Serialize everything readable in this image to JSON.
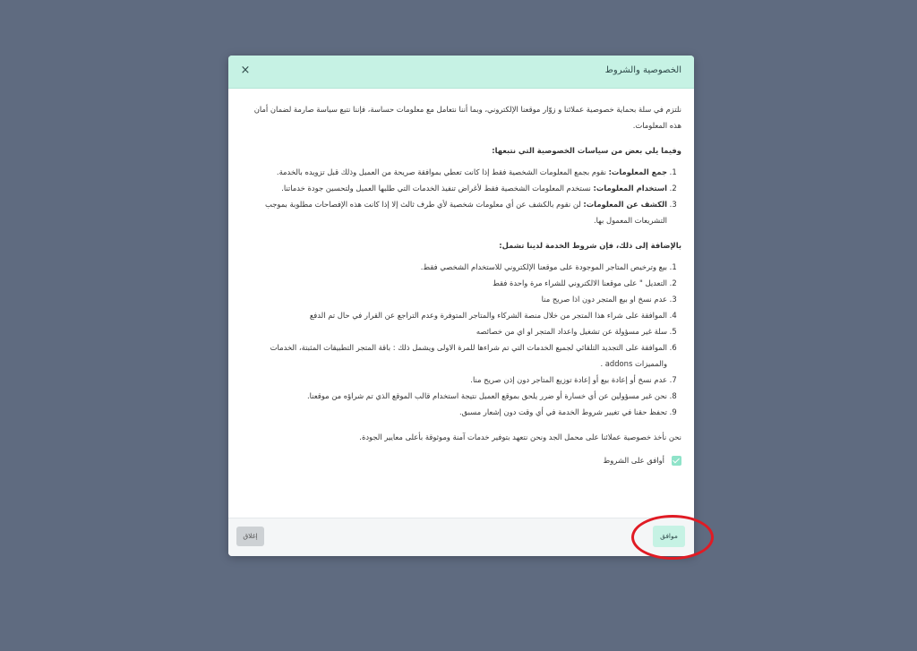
{
  "modal": {
    "title": "الخصوصية والشروط",
    "close_icon": "×",
    "intro": "نلتزم في سلة بحماية خصوصية عملائنا و زوّار موقعنا الإلكتروني، وبما أننا نتعامل مع معلومات حساسة، فإننا نتبع سياسة صارمة لضمان أمان هذه المعلومات.",
    "privacy_title": "وفيما يلي بعض من سياسات الخصوصية التي نتبعها:",
    "privacy_items": [
      {
        "bold": "جمع المعلومات:",
        "text": " نقوم بجمع المعلومات الشخصية فقط إذا كانت تعطي بموافقة صريحة من العميل وذلك قبل تزويده بالخدمة."
      },
      {
        "bold": "استخدام المعلومات:",
        "text": " نستخدم المعلومات الشخصية فقط لأغراض تنفيذ الخدمات التي طلبها العميل ولتحسين جودة خدماتنا."
      },
      {
        "bold": "الكشف عن المعلومات:",
        "text": " لن نقوم بالكشف عن أي معلومات شخصية لأي طرف ثالث إلا إذا كانت هذه الإفصاحات مطلوبة بموجب التشريعات المعمول بها."
      }
    ],
    "terms_title": "بالإضافة إلى ذلك، فإن شروط الخدمة لدينا تشمل:",
    "terms_items": [
      "بيع وترخيص المتاجر الموجودة على موقعنا الإلكتروني للاستخدام الشخصي فقط.",
      "التعديل \" على موقعنا الالكتروني للشراء مرة واحدة فقط",
      "عدم نسخ او بيع المتجر دون اذا صريح منا",
      "الموافقة على شراء هذا المتجر من خلال منصة الشركاء والمتاجر المتوفرة وعدم التراجع عن القرار في حال تم الدفع",
      "سلة غير مسؤولة عن تشغيل واعداد المتجر او اي من خصائصه",
      "الموافقة على التجديد التلقائي لجميع الخدمات التي تم شراءها للمرة الاولى ويشمل ذلك : باقة المتجر التطبيقات المثبتة، الخدمات والمميزات addons .",
      "عدم نسخ أو إعادة بيع أو إعادة توزيع  المتاجر دون إذن صريح منا.",
      "نحن غير مسؤولين عن أي خسارة أو ضرر يلحق بموقع العميل نتيجة استخدام قالب الموقع الذي تم شراؤه من موقعنا.",
      "تحفظ حقنا في تغيير شروط الخدمة في أي وقت دون إشعار مسبق."
    ],
    "closing": "نحن نأخذ خصوصية عملائنا على محمل الجد ونحن نتعهد بتوفير خدمات آمنة وموثوقة بأعلى معايير الجودة.",
    "agree_label": "أوافق على الشروط",
    "agree_checked": true,
    "footer": {
      "agree_button": "موافق",
      "close_button": "إغلاق"
    }
  },
  "colors": {
    "overlay": "#5f6b80",
    "header_bg": "#c6f2e4",
    "checkbox": "#8fe3c9",
    "highlight_ring": "#e01b24"
  }
}
